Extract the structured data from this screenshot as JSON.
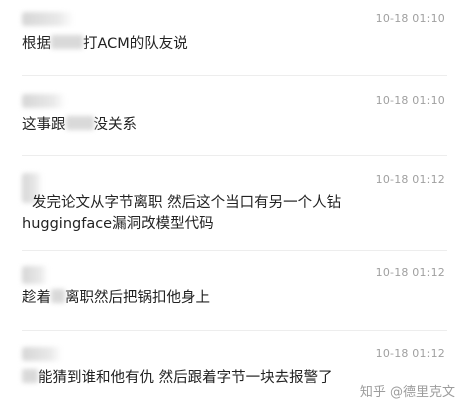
{
  "comments": [
    {
      "timestamp": "10-18 01:10",
      "text_before": "根据",
      "text_after": "打ACM的队友说"
    },
    {
      "timestamp": "10-18 01:10",
      "text_before": "这事跟",
      "text_after": "没关系"
    },
    {
      "timestamp": "10-18 01:12",
      "text_line1": "发完论文从字节离职 然后这个当口有另一个人钻",
      "text_line2": "huggingface漏洞改模型代码"
    },
    {
      "timestamp": "10-18 01:12",
      "text_before": "趁着",
      "text_after": "离职然后把锅扣他身上"
    },
    {
      "timestamp": "10-18 01:12",
      "text_after": "能猜到谁和他有仇 然后跟着字节一块去报警了"
    }
  ],
  "watermark": "知乎 @德里克文"
}
